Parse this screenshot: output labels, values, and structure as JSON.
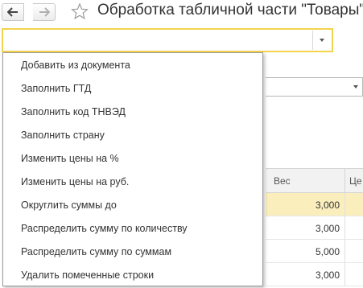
{
  "window": {
    "title": "Обработка табличной части \"Товары\""
  },
  "combo": {
    "value": ""
  },
  "grid": {
    "columns": [
      "Вес",
      "Це"
    ],
    "rows": [
      {
        "weight": "3,000",
        "selected": true
      },
      {
        "weight": "3,000",
        "selected": false
      },
      {
        "weight": "5,000",
        "selected": false
      },
      {
        "weight": "3,000",
        "selected": false
      }
    ]
  },
  "menu": {
    "items": [
      "Добавить из документа",
      "Заполнить ГТД",
      "Заполнить код ТНВЭД",
      "Заполнить страну",
      "Изменить цены на %",
      "Изменить цены на руб.",
      "Округлить суммы до",
      "Распределить сумму по количеству",
      "Распределить сумму по суммам",
      "Удалить помеченные строки"
    ]
  },
  "colors": {
    "accent_border": "#f3d44d",
    "selected_row": "#fbeebd"
  }
}
